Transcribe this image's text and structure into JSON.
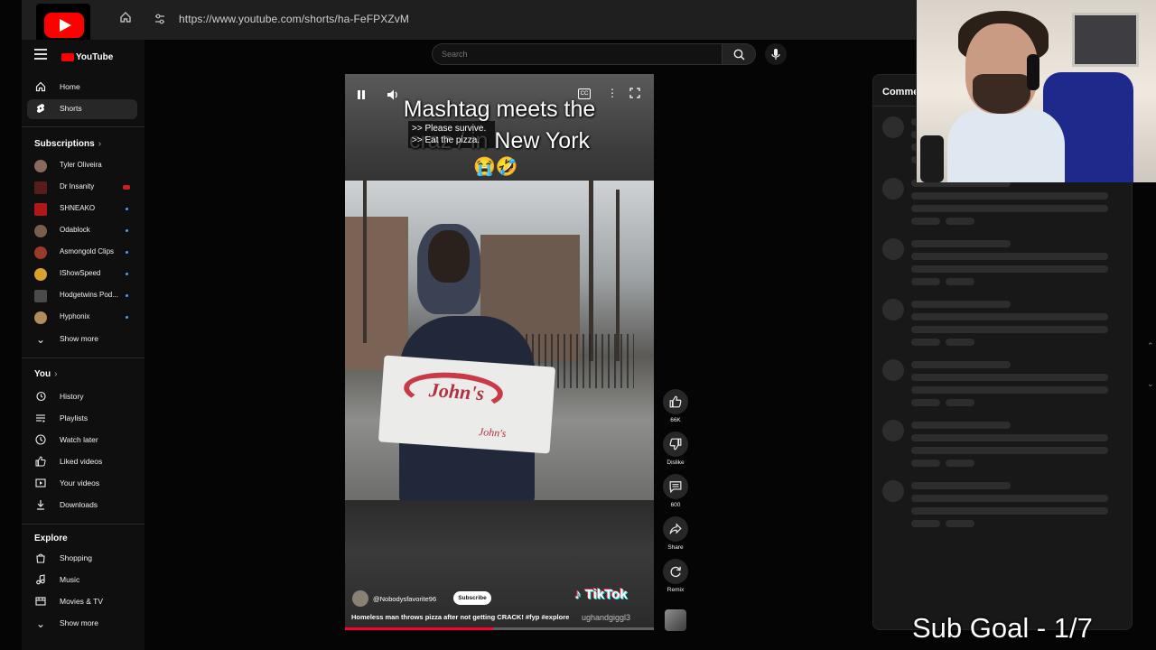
{
  "browser": {
    "url": "https://www.youtube.com/shorts/ha-FeFPXZvM"
  },
  "header": {
    "logo_text": "YouTube",
    "search_placeholder": "Search"
  },
  "sidebar": {
    "main": [
      {
        "label": "Home",
        "icon": "home-icon"
      },
      {
        "label": "Shorts",
        "icon": "shorts-icon",
        "active": true
      }
    ],
    "subscriptions_title": "Subscriptions",
    "subscriptions": [
      {
        "label": "Tyler Oliveira",
        "indicator": "none",
        "avatar_color": "#8a6a5a"
      },
      {
        "label": "Dr Insanity",
        "indicator": "live",
        "avatar_color": "#5a1b1b"
      },
      {
        "label": "SHNEAKO",
        "indicator": "dot",
        "avatar_color": "#b01818"
      },
      {
        "label": "Odablock",
        "indicator": "dot",
        "avatar_color": "#7a5e4a"
      },
      {
        "label": "Asmongold Clips",
        "indicator": "dot",
        "avatar_color": "#9a3a2a"
      },
      {
        "label": "IShowSpeed",
        "indicator": "dot",
        "avatar_color": "#d9a030"
      },
      {
        "label": "Hodgetwins Pod...",
        "indicator": "dot",
        "avatar_color": "#4a4a4a"
      },
      {
        "label": "Hyphonix",
        "indicator": "dot",
        "avatar_color": "#b58b5a"
      }
    ],
    "subscriptions_more": "Show more",
    "you_title": "You",
    "you_items": [
      {
        "label": "History",
        "icon": "history-icon"
      },
      {
        "label": "Playlists",
        "icon": "playlists-icon"
      },
      {
        "label": "Watch later",
        "icon": "watch-later-icon"
      },
      {
        "label": "Liked videos",
        "icon": "liked-videos-icon"
      },
      {
        "label": "Your videos",
        "icon": "your-videos-icon"
      },
      {
        "label": "Downloads",
        "icon": "downloads-icon"
      }
    ],
    "explore_title": "Explore",
    "explore_items": [
      {
        "label": "Shopping",
        "icon": "shopping-icon"
      },
      {
        "label": "Music",
        "icon": "music-icon"
      },
      {
        "label": "Movies & TV",
        "icon": "movies-icon"
      }
    ],
    "explore_more": "Show more"
  },
  "short": {
    "overlay_title": "Mashtag meets the\ncraz         / in New York",
    "caption_lines": [
      ">> Please survive.",
      ">> Eat the pizza."
    ],
    "emoji": "😭🤣",
    "pizza_box_text": "John's",
    "pizza_box_text_small": "John's",
    "channel": "@Nobodysfavorite96",
    "subscribe_label": "Subscribe",
    "tiktok_label": "TikTok",
    "description": "Homeless man throws pizza after not getting CRACK! #fyp #explore",
    "watermark": "ughandgiggl3",
    "progress": 0.48
  },
  "actions": {
    "like_count": "66K",
    "dislike_label": "Dislike",
    "comments_count": "600",
    "share_label": "Share",
    "remix_label": "Remix"
  },
  "comments": {
    "title": "Comme"
  },
  "overlay": {
    "sub_goal": "Sub Goal - 1/7"
  },
  "colors": {
    "brand_red": "#ff0000",
    "progress_red": "#ff0033",
    "live_indicator": "#cc1f1f",
    "new_dot": "#3ea6ff"
  }
}
